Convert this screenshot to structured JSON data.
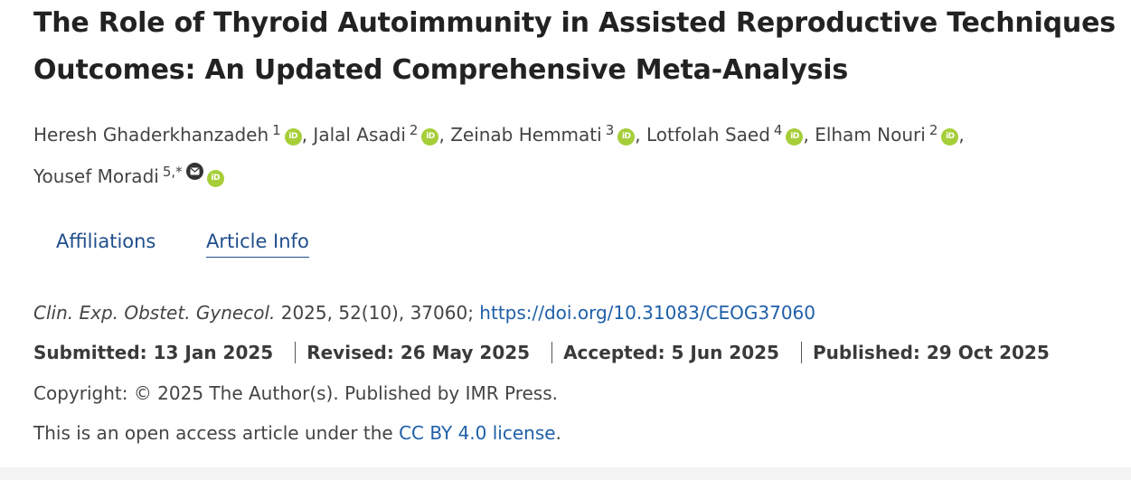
{
  "article": {
    "title": "The Role of Thyroid Autoimmunity in Assisted Reproductive Techniques Outcomes: An Updated Comprehensive Meta-Analysis"
  },
  "authors": [
    {
      "name": "Heresh Ghaderkhanzadeh",
      "affil": "1",
      "separator": ","
    },
    {
      "name": "Jalal Asadi",
      "affil": "2",
      "separator": ","
    },
    {
      "name": "Zeinab Hemmati",
      "affil": "3",
      "separator": ","
    },
    {
      "name": "Lotfolah Saed",
      "affil": "4",
      "separator": ","
    },
    {
      "name": "Elham Nouri",
      "affil": "2",
      "separator": ","
    },
    {
      "name": "Yousef Moradi",
      "affil": "5,*",
      "separator": ""
    }
  ],
  "icons": {
    "orcid_label": "iD",
    "orcid_color": "#a6ce39",
    "mail_icon": "envelope-icon"
  },
  "tabs": {
    "affiliations": "Affiliations",
    "article_info": "Article Info"
  },
  "citation": {
    "journal": "Clin. Exp. Obstet. Gynecol.",
    "details": "2025, 52(10), 37060;",
    "doi": "https://doi.org/10.31083/CEOG37060"
  },
  "dates": {
    "submitted": "Submitted: 13 Jan 2025",
    "revised": "Revised: 26 May 2025",
    "accepted": "Accepted: 5 Jun 2025",
    "published": "Published: 29 Oct 2025"
  },
  "copyright": "Copyright: © 2025 The Author(s). Published by IMR Press.",
  "license": {
    "prefix": "This is an open access article under the",
    "link": "CC BY 4.0 license",
    "suffix": "."
  },
  "colors": {
    "link": "#1f5fa8",
    "tab": "#1f4e8c",
    "title": "#222222"
  }
}
